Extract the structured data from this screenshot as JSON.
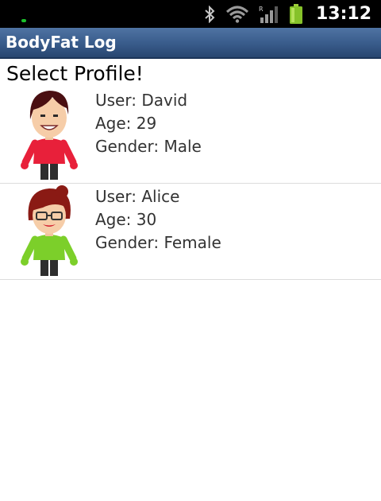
{
  "status_bar": {
    "time": "13:12",
    "icons": [
      "bluetooth-icon",
      "wifi-icon",
      "signal-icon",
      "battery-icon"
    ],
    "roaming_marker": "R"
  },
  "app": {
    "title": "BodyFat Log"
  },
  "heading": "Select Profile!",
  "profiles": [
    {
      "user_label": "User: David",
      "age_label": "Age: 29",
      "gender_label": "Gender: Male",
      "avatar": "male-avatar"
    },
    {
      "user_label": "User: Alice",
      "age_label": "Age: 30",
      "gender_label": "Gender: Female",
      "avatar": "female-avatar"
    }
  ],
  "colors": {
    "title_bar": "#385b8a",
    "status_bar": "#000000",
    "david_shirt": "#e8203a",
    "alice_shirt": "#7ccf2a"
  }
}
